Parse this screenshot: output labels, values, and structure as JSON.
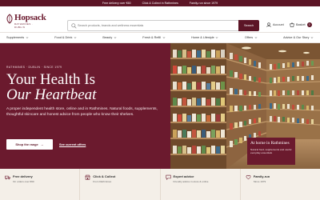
{
  "topbar": {
    "items": [
      "Free delivery over €60",
      "Click & Collect in Rathmines",
      "Family-run since 1979"
    ]
  },
  "header": {
    "logo_name": "Hopsack",
    "logo_sub": "RATHMINES · DUBLIN",
    "search_placeholder": "Search products, brands and wellness essentials",
    "search_button": "Search",
    "account_label": "Account",
    "basket_label": "Basket",
    "basket_count": "0"
  },
  "nav": {
    "items": [
      "Supplements",
      "Food & Drink",
      "Beauty",
      "Fresh & Refill",
      "Home & Lifestyle",
      "Offers",
      "Advice & Our Story"
    ]
  },
  "hero": {
    "eyebrow": "RATHMINES · DUBLIN · SINCE 1979",
    "headline_line1": "Your Health Is",
    "headline_line2": "Our Heartbeat",
    "description": "A proper independent health store, online and in Rathmines. Natural foods, supplements, thoughtful skincare and honest advice from people who know their shelves.",
    "primary_button": "Shop the range",
    "secondary_link": "See current offers",
    "caption_title": "At home in Rathmines",
    "caption_text": "Natural food, supplements and useful everyday essentials"
  },
  "features": [
    {
      "title": "Free delivery",
      "sub": "On orders over €60",
      "icon": "truck-icon"
    },
    {
      "title": "Click & Collect",
      "sub": "From Rathmines",
      "icon": "store-icon"
    },
    {
      "title": "Expert advice",
      "sub": "Friendly advice in-store & online",
      "icon": "chat-icon"
    },
    {
      "title": "Family-run",
      "sub": "Since 1979",
      "icon": "heart-icon"
    }
  ],
  "colors": {
    "brand": "#6b1a2e",
    "brand_dark": "#5c1526",
    "cream": "#f4efe8"
  }
}
